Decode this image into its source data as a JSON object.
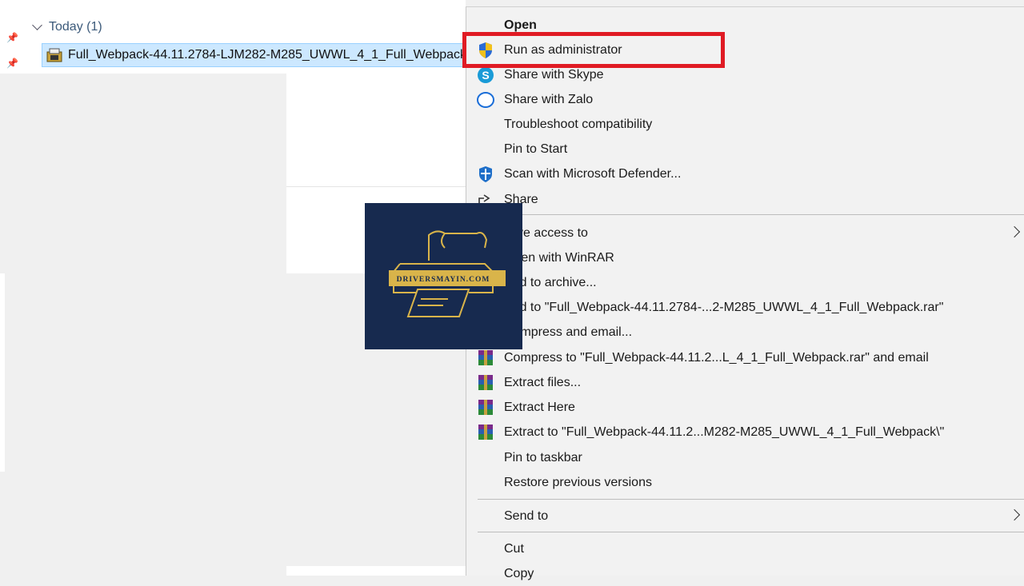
{
  "explorer": {
    "group_header": "Today (1)",
    "file_name": "Full_Webpack-44.11.2784-LJM282-M285_UWWL_4_1_Full_Webpack"
  },
  "logo": {
    "text": "DRIVERSMAYIN.COM"
  },
  "colors": {
    "highlight": "#e01b24",
    "logo_bg": "#172a4f",
    "logo_gold": "#d9b44a",
    "selection": "#cce8ff"
  },
  "context_menu": {
    "items": [
      {
        "label": "Open",
        "icon": "none"
      },
      {
        "label": "Run as administrator",
        "icon": "uac-shield-icon"
      },
      {
        "label": "Share with Skype",
        "icon": "skype-icon"
      },
      {
        "label": "Share with Zalo",
        "icon": "zalo-icon"
      },
      {
        "label": "Troubleshoot compatibility",
        "icon": "none"
      },
      {
        "label": "Pin to Start",
        "icon": "none"
      },
      {
        "label": "Scan with Microsoft Defender...",
        "icon": "defender-icon"
      },
      {
        "label": "Share",
        "icon": "share-icon"
      },
      {
        "label": "Give access to",
        "icon": "none",
        "submenu": true
      },
      {
        "label": "Open with WinRAR",
        "icon": "winrar-icon"
      },
      {
        "label": "Add to archive...",
        "icon": "winrar-icon"
      },
      {
        "label": "Add to \"Full_Webpack-44.11.2784-...2-M285_UWWL_4_1_Full_Webpack.rar\"",
        "icon": "winrar-icon"
      },
      {
        "label": "Compress and email...",
        "icon": "winrar-icon"
      },
      {
        "label": "Compress to \"Full_Webpack-44.11.2...L_4_1_Full_Webpack.rar\" and email",
        "icon": "winrar-icon"
      },
      {
        "label": "Extract files...",
        "icon": "winrar-icon"
      },
      {
        "label": "Extract Here",
        "icon": "winrar-icon"
      },
      {
        "label": "Extract to \"Full_Webpack-44.11.2...M282-M285_UWWL_4_1_Full_Webpack\\\"",
        "icon": "winrar-icon"
      },
      {
        "label": "Pin to taskbar",
        "icon": "none"
      },
      {
        "label": "Restore previous versions",
        "icon": "none"
      },
      {
        "label": "Send to",
        "icon": "none",
        "submenu": true
      },
      {
        "label": "Cut",
        "icon": "none"
      },
      {
        "label": "Copy",
        "icon": "none"
      }
    ]
  }
}
